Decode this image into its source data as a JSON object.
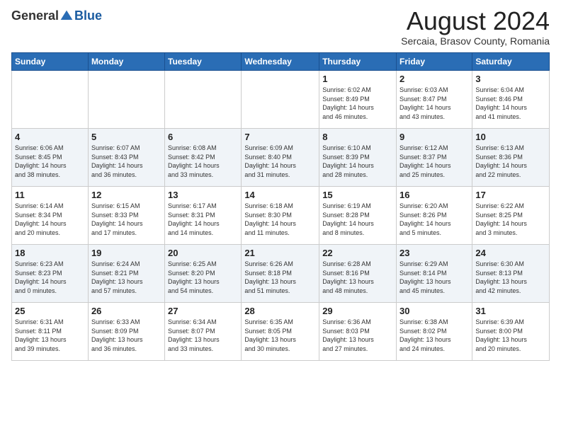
{
  "logo": {
    "general": "General",
    "blue": "Blue"
  },
  "title": {
    "month_year": "August 2024",
    "location": "Sercaia, Brasov County, Romania"
  },
  "days_of_week": [
    "Sunday",
    "Monday",
    "Tuesday",
    "Wednesday",
    "Thursday",
    "Friday",
    "Saturday"
  ],
  "weeks": [
    [
      {
        "day": "",
        "info": ""
      },
      {
        "day": "",
        "info": ""
      },
      {
        "day": "",
        "info": ""
      },
      {
        "day": "",
        "info": ""
      },
      {
        "day": "1",
        "info": "Sunrise: 6:02 AM\nSunset: 8:49 PM\nDaylight: 14 hours\nand 46 minutes."
      },
      {
        "day": "2",
        "info": "Sunrise: 6:03 AM\nSunset: 8:47 PM\nDaylight: 14 hours\nand 43 minutes."
      },
      {
        "day": "3",
        "info": "Sunrise: 6:04 AM\nSunset: 8:46 PM\nDaylight: 14 hours\nand 41 minutes."
      }
    ],
    [
      {
        "day": "4",
        "info": "Sunrise: 6:06 AM\nSunset: 8:45 PM\nDaylight: 14 hours\nand 38 minutes."
      },
      {
        "day": "5",
        "info": "Sunrise: 6:07 AM\nSunset: 8:43 PM\nDaylight: 14 hours\nand 36 minutes."
      },
      {
        "day": "6",
        "info": "Sunrise: 6:08 AM\nSunset: 8:42 PM\nDaylight: 14 hours\nand 33 minutes."
      },
      {
        "day": "7",
        "info": "Sunrise: 6:09 AM\nSunset: 8:40 PM\nDaylight: 14 hours\nand 31 minutes."
      },
      {
        "day": "8",
        "info": "Sunrise: 6:10 AM\nSunset: 8:39 PM\nDaylight: 14 hours\nand 28 minutes."
      },
      {
        "day": "9",
        "info": "Sunrise: 6:12 AM\nSunset: 8:37 PM\nDaylight: 14 hours\nand 25 minutes."
      },
      {
        "day": "10",
        "info": "Sunrise: 6:13 AM\nSunset: 8:36 PM\nDaylight: 14 hours\nand 22 minutes."
      }
    ],
    [
      {
        "day": "11",
        "info": "Sunrise: 6:14 AM\nSunset: 8:34 PM\nDaylight: 14 hours\nand 20 minutes."
      },
      {
        "day": "12",
        "info": "Sunrise: 6:15 AM\nSunset: 8:33 PM\nDaylight: 14 hours\nand 17 minutes."
      },
      {
        "day": "13",
        "info": "Sunrise: 6:17 AM\nSunset: 8:31 PM\nDaylight: 14 hours\nand 14 minutes."
      },
      {
        "day": "14",
        "info": "Sunrise: 6:18 AM\nSunset: 8:30 PM\nDaylight: 14 hours\nand 11 minutes."
      },
      {
        "day": "15",
        "info": "Sunrise: 6:19 AM\nSunset: 8:28 PM\nDaylight: 14 hours\nand 8 minutes."
      },
      {
        "day": "16",
        "info": "Sunrise: 6:20 AM\nSunset: 8:26 PM\nDaylight: 14 hours\nand 5 minutes."
      },
      {
        "day": "17",
        "info": "Sunrise: 6:22 AM\nSunset: 8:25 PM\nDaylight: 14 hours\nand 3 minutes."
      }
    ],
    [
      {
        "day": "18",
        "info": "Sunrise: 6:23 AM\nSunset: 8:23 PM\nDaylight: 14 hours\nand 0 minutes."
      },
      {
        "day": "19",
        "info": "Sunrise: 6:24 AM\nSunset: 8:21 PM\nDaylight: 13 hours\nand 57 minutes."
      },
      {
        "day": "20",
        "info": "Sunrise: 6:25 AM\nSunset: 8:20 PM\nDaylight: 13 hours\nand 54 minutes."
      },
      {
        "day": "21",
        "info": "Sunrise: 6:26 AM\nSunset: 8:18 PM\nDaylight: 13 hours\nand 51 minutes."
      },
      {
        "day": "22",
        "info": "Sunrise: 6:28 AM\nSunset: 8:16 PM\nDaylight: 13 hours\nand 48 minutes."
      },
      {
        "day": "23",
        "info": "Sunrise: 6:29 AM\nSunset: 8:14 PM\nDaylight: 13 hours\nand 45 minutes."
      },
      {
        "day": "24",
        "info": "Sunrise: 6:30 AM\nSunset: 8:13 PM\nDaylight: 13 hours\nand 42 minutes."
      }
    ],
    [
      {
        "day": "25",
        "info": "Sunrise: 6:31 AM\nSunset: 8:11 PM\nDaylight: 13 hours\nand 39 minutes."
      },
      {
        "day": "26",
        "info": "Sunrise: 6:33 AM\nSunset: 8:09 PM\nDaylight: 13 hours\nand 36 minutes."
      },
      {
        "day": "27",
        "info": "Sunrise: 6:34 AM\nSunset: 8:07 PM\nDaylight: 13 hours\nand 33 minutes."
      },
      {
        "day": "28",
        "info": "Sunrise: 6:35 AM\nSunset: 8:05 PM\nDaylight: 13 hours\nand 30 minutes."
      },
      {
        "day": "29",
        "info": "Sunrise: 6:36 AM\nSunset: 8:03 PM\nDaylight: 13 hours\nand 27 minutes."
      },
      {
        "day": "30",
        "info": "Sunrise: 6:38 AM\nSunset: 8:02 PM\nDaylight: 13 hours\nand 24 minutes."
      },
      {
        "day": "31",
        "info": "Sunrise: 6:39 AM\nSunset: 8:00 PM\nDaylight: 13 hours\nand 20 minutes."
      }
    ]
  ]
}
